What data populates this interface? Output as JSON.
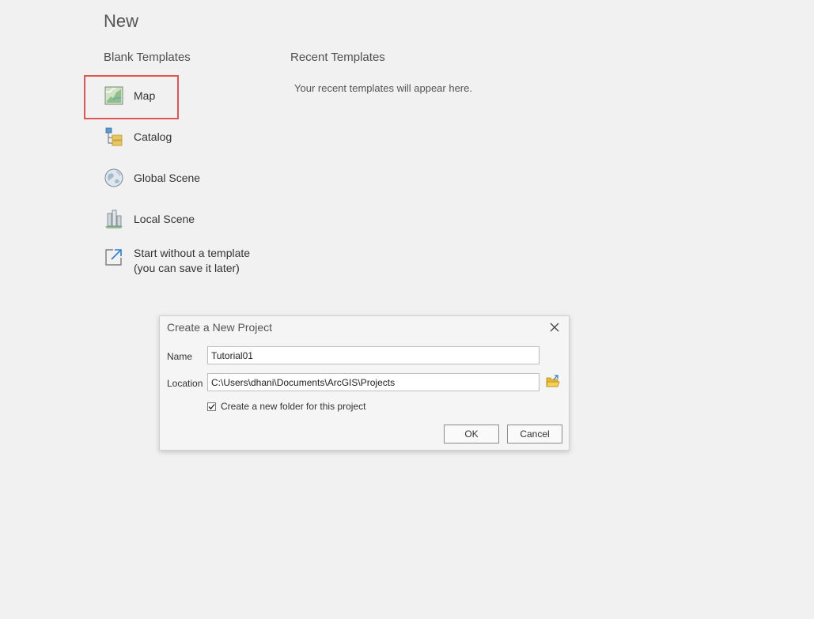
{
  "page": {
    "title": "New",
    "blank_heading": "Blank Templates",
    "recent_heading": "Recent Templates",
    "recent_empty": "Your recent templates will appear here."
  },
  "templates": [
    {
      "label": "Map",
      "icon": "map-icon"
    },
    {
      "label": "Catalog",
      "icon": "catalog-icon"
    },
    {
      "label": "Global Scene",
      "icon": "globe-icon"
    },
    {
      "label": "Local Scene",
      "icon": "local-scene-icon"
    },
    {
      "label_line1": "Start without a template",
      "label_line2": "(you can save it later)",
      "icon": "open-arrow-icon"
    }
  ],
  "dialog": {
    "title": "Create a New Project",
    "name_label": "Name",
    "name_value": "Tutorial01",
    "location_label": "Location",
    "location_value": "C:\\Users\\dhani\\Documents\\ArcGIS\\Projects",
    "create_folder_label": "Create a new folder for this project",
    "create_folder_checked": true,
    "ok_label": "OK",
    "cancel_label": "Cancel"
  },
  "colors": {
    "background": "#f1f1f1",
    "highlight": "#e05555",
    "folder": "#e8b830"
  }
}
